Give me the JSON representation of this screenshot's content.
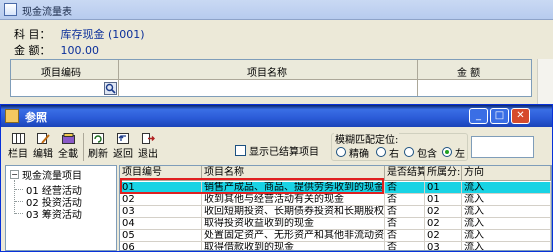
{
  "main_window": {
    "title": "现金流量表",
    "subject_label": "科 目：",
    "subject_value": "库存现金 (1001)",
    "amount_label": "金 额：",
    "amount_value": "100.00",
    "columns": [
      "项目编码",
      "项目名称",
      "金 额"
    ]
  },
  "dialog": {
    "title": "参照",
    "toolbar": [
      {
        "label": "栏目",
        "icon": "columns-icon"
      },
      {
        "label": "编辑",
        "icon": "edit-icon"
      },
      {
        "label": "全載",
        "icon": "load-all-icon"
      },
      {
        "label": "刷新",
        "icon": "refresh-icon"
      },
      {
        "label": "返回",
        "icon": "return-icon"
      },
      {
        "label": "退出",
        "icon": "exit-icon"
      }
    ],
    "show_closed_label": "显示已结算项目",
    "fuzzy_label": "模糊匹配定位:",
    "fuzzy_options": [
      "精确",
      "右",
      "包含",
      "左"
    ],
    "fuzzy_selected": "左",
    "search_value": "",
    "tree": {
      "root": "现金流量项目",
      "children": [
        "01 经营活动",
        "02 投资活动",
        "03 筹资活动"
      ]
    },
    "grid": {
      "columns": [
        "项目编号",
        "项目名称",
        "是否结算",
        "所属分:",
        "方向"
      ],
      "rows": [
        [
          "01",
          "销售产成品、商品、提供劳务收到的现金",
          "否",
          "01",
          "流入"
        ],
        [
          "02",
          "收到其他与经营活动有关的现金",
          "否",
          "01",
          "流入"
        ],
        [
          "03",
          "收回短期投资、长期债券投资和长期股权投",
          "否",
          "02",
          "流入"
        ],
        [
          "04",
          "取得投资收益收到的现金",
          "否",
          "02",
          "流入"
        ],
        [
          "05",
          "处置固定资产、无形资产和其他非流动资产",
          "否",
          "02",
          "流入"
        ],
        [
          "06",
          "取得借款收到的现金",
          "否",
          "03",
          "流入"
        ]
      ],
      "selected_row": 0
    },
    "colors": {
      "title_bar": "#2b5bd7",
      "selection": "#19d3e4",
      "highlight_border": "#e02020"
    }
  }
}
